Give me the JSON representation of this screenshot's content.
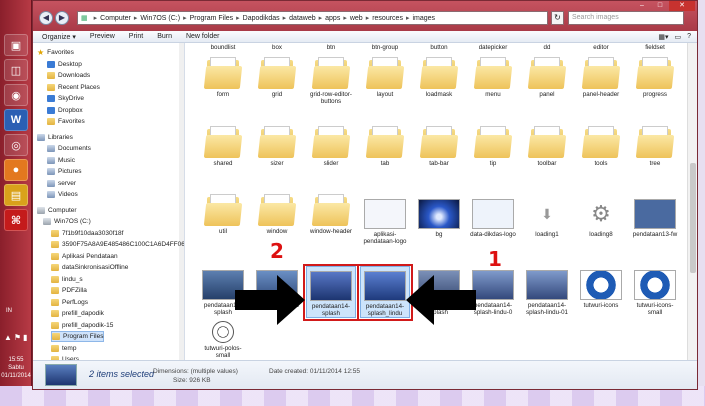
{
  "window": {
    "address": [
      "Computer",
      "Win7OS (C:)",
      "Program Files",
      "Dapodikdas",
      "dataweb",
      "apps",
      "web",
      "resources",
      "images"
    ],
    "search_placeholder": "Search images",
    "toolbar": {
      "organize": "Organize ▾",
      "preview": "Preview",
      "print": "Print",
      "burn": "Burn",
      "new_folder": "New folder"
    }
  },
  "taskbar": {
    "lang": "IN",
    "clock_time": "15:55",
    "clock_day": "Sabtu",
    "clock_date": "01/11/2014"
  },
  "navpane": {
    "favorites": "Favorites",
    "fav_items": [
      "Desktop",
      "Downloads",
      "Recent Places",
      "SkyDrive",
      "Dropbox",
      "Favorites"
    ],
    "libraries": "Libraries",
    "lib_items": [
      "Documents",
      "Music",
      "Pictures",
      "server",
      "Videos"
    ],
    "computer": "Computer",
    "drive": "Win7OS (C:)",
    "folders": [
      "7f1b9f10daa3030f18f",
      "3590F75A8A9E485486C100C1A6D4FF06ZZZ...",
      "Aplikasi Pendataan",
      "dataSinkronisasiOffline",
      "lindu_s",
      "PDFZilla",
      "PerfLogs",
      "prefill_dapodik",
      "prefill_dapodik-15",
      "Program Files",
      "temp",
      "Users",
      "Windows"
    ]
  },
  "content": {
    "top_labels": [
      "boundlist",
      "box",
      "btn",
      "btn-group",
      "button",
      "datepicker",
      "dd",
      "editor",
      "fieldset"
    ],
    "row1": [
      "form",
      "grid",
      "grid-row-editor-buttons",
      "layout",
      "loadmask",
      "menu",
      "panel",
      "panel-header",
      "progress"
    ],
    "row2": [
      "shared",
      "sizer",
      "slider",
      "tab",
      "tab-bar",
      "tip",
      "toolbar",
      "tools",
      "tree"
    ],
    "row3": [
      "util",
      "window",
      "window-header",
      "aplikasi-pendataan-logo",
      "bg",
      "data-dikdas-logo",
      "loading1",
      "loading8",
      "pendataan13-fw"
    ],
    "row4": [
      "pendataan13-splash",
      "pendataan14-fw",
      "pendataan14-splash",
      "pendataan14-splash_lindu",
      "pendataan14-splash",
      "pendataan14-splash-lindu-0",
      "pendataan14-splash-lindu-01",
      "tutwuri-icons",
      "tutwuri-icons-small"
    ],
    "row5": [
      "tutwuri-polos-small"
    ]
  },
  "annotations": {
    "num1": "1",
    "num2": "2"
  },
  "details": {
    "selected": "2 items selected",
    "dimensions_label": "Dimensions:",
    "dimensions_value": "(multiple values)",
    "size_label": "Size:",
    "size_value": "926 KB",
    "date_label": "Date created:",
    "date_value": "01/11/2014 12:55"
  },
  "colors": {
    "taskbar": "#a52e3b",
    "selection": "#cde4fb",
    "highlight_red": "#d11a1a"
  }
}
